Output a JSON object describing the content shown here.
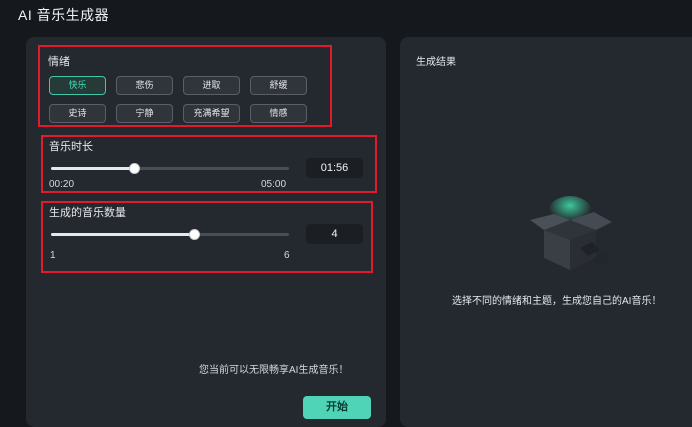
{
  "app": {
    "title": "AI 音乐生成器"
  },
  "mood": {
    "label": "情绪",
    "tags": [
      "快乐",
      "悲伤",
      "进取",
      "舒缓",
      "史诗",
      "宁静",
      "充满希望",
      "情感"
    ],
    "active_index": 0
  },
  "duration": {
    "label": "音乐时长",
    "value": "01:56",
    "min_label": "00:20",
    "max_label": "05:00",
    "level_fraction": 0.35
  },
  "count": {
    "label": "生成的音乐数量",
    "value": "4",
    "min_label": "1",
    "max_label": "6",
    "level_fraction": 0.6
  },
  "footer": {
    "note": "您当前可以无限畅享AI生成音乐！",
    "start_label": "开始"
  },
  "result": {
    "title": "生成结果",
    "hint": "选择不同的情绪和主题，生成您自己的AI音乐！"
  },
  "colors": {
    "accent": "#4fd4b8",
    "highlight_box": "#e11a2c",
    "panel": "#24282f",
    "background": "#15181d"
  },
  "icons": {
    "empty_state": "open-box-icon"
  }
}
